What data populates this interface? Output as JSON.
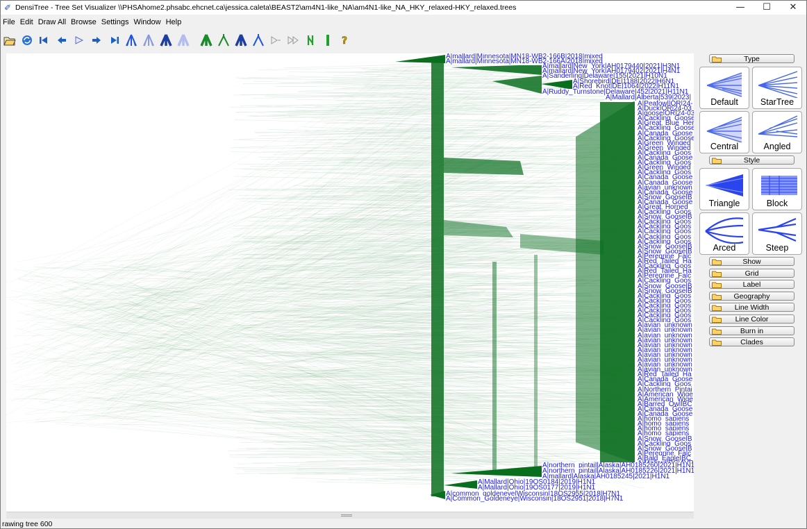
{
  "window": {
    "title": "DensiTree - Tree Set Visualizer \\\\PHSAhome2.phsabc.ehcnet.ca\\jessica.caleta\\BEAST2\\am4N1-like_NA\\am4N1-like_NA_HKY_relaxed-HKY_relaxed.trees",
    "minimize": "—",
    "maximize": "☐",
    "close": "✕"
  },
  "menu": [
    "File",
    "Edit",
    "Draw All",
    "Browse",
    "Settings",
    "Window",
    "Help"
  ],
  "toolbar_icons": [
    "open-icon",
    "refresh-icon",
    "first-tree-icon",
    "previous-tree-icon",
    "play-icon",
    "next-tree-icon",
    "last-tree-icon",
    "tree-view-blue-icon",
    "tree-view-light-icon",
    "tree-view-dark-icon",
    "tree-view-pale-icon",
    "tree-view-green-icon",
    "tree-view-green-light-icon",
    "tree-view-navy-icon",
    "tree-view-blue-outline-icon",
    "step-forward-icon",
    "step-forward-double-icon",
    "split-green-icon",
    "bar-green-icon",
    "help-icon"
  ],
  "colors": {
    "tree": "#0a6e1f",
    "label": "#1a1aee",
    "accent": "#ffd266"
  },
  "status": "rawing tree 600",
  "panel": {
    "sections": [
      "Type",
      "Style",
      "Show",
      "Grid",
      "Label",
      "Geography",
      "Line Width",
      "Line Color",
      "Burn in",
      "Clades"
    ],
    "type_tiles": [
      "Default",
      "StarTree",
      "Central",
      "Angled"
    ],
    "style_tiles": [
      "Triangle",
      "Block",
      "Arced",
      "Steep"
    ]
  },
  "tip_labels": {
    "top": [
      "A|mallard|Minnesota|MN18-WB2-166B|2018|mixed",
      "A|mallard|Minnesota|MN18-WB2-166A|2018|mixed",
      "A|mallard|New_York|AH0179440|2021|H3N1",
      "A|mallard|New_York|AH0179402|2021|H4N1",
      "A|Sanderling|Delaware|155|2021|H10N1",
      "A|Shorebird|DE|1188|2022|H6N1",
      "A|Red_Knot|DE|1064|2022|H11N1",
      "A|Ruddy_Turnstone|Delaware|452|2021|H11N1",
      "A|Mallard|Alberta|539|2023|"
    ],
    "column": [
      "A|Peafowl|OR|24-",
      "A|Duck|OR|24-03",
      "A|goose|OR|24-03",
      "A|Cackling_Goose",
      "A|Great_Blue_Her",
      "A|Cackling_Goose",
      "A|Canada_Goose",
      "A|Cackling_Goose",
      "A|Green_Winged",
      "A|Green_Winged",
      "A|Cackling_Goos",
      "A|Canada_Goose",
      "A|Cackling_Goos",
      "A|Green_Winged",
      "A|Cackling_Goos",
      "A|Canada_Goose",
      "A|Canada_Goose",
      "A|avian_unknown",
      "A|Canada_Goose",
      "A|Snow_Goose|B",
      "A|Canada_Goose",
      "A|Great_Horned_",
      "A|Cackling_Goos",
      "A|Snow_Goose|B",
      "A|Cackling_Goos",
      "A|Cackling_Goos",
      "A|Cackling_Goos",
      "A|Cackling_Goos",
      "A|Cackling_Goos",
      "A|Snow_Goose|B",
      "A|Snow_Goose|B",
      "A|Peregrine_Falc",
      "A|Red_Tailed_Ha",
      "A|Cackling_Goos",
      "A|Red_Tailed_Ha",
      "A|Peregrine_Falc",
      "A|Cackling_Goos",
      "A|Snow_Goose|B",
      "A|Snow_Goose|B",
      "A|Cackling_Goos",
      "A|Cackling_Goos",
      "A|Cackling_Goos",
      "A|Cackling_Goos",
      "A|Cackling_Goos",
      "A|Cackling_Goos",
      "A|avian_unknown",
      "A|avian_unknown",
      "A|avian_unknown",
      "A|avian_unknown",
      "A|avian_unknown",
      "A|avian_unknown",
      "A|avian_unknown",
      "A|avian_unknown",
      "A|avian_unknown",
      "A|avian_unknown",
      "A|Red_Tailed_Ha",
      "A|Canada_Goose",
      "A|Cackling_Goos",
      "A|Northern_Pintai",
      "A|American_Wige",
      "A|American_Wige",
      "A|Barred_Owl|BC",
      "A|Canada_Goose",
      "A|Canada_Goose",
      "A|homo_sapiens",
      "A|homo_sapiens",
      "A|homo_sapiens",
      "A|homo_sapiens",
      "A|Snow_Goose|B",
      "A|Cackling_Goos",
      "A|Snow_Goose|B",
      "A|Peregrine_Falc",
      "A|Bald_Eagle|BC",
      "A|Mallard|BC|AVP"
    ],
    "bottom": [
      "A|northern_pintail|Alaska|AH0185260|2021|H1N1",
      "A|northern_pintail|Alaska|AH0185226|2021|H1N1",
      "A|mallard|Alaska|AH0185245|2021|H1N1",
      "A|Mallard|Ohio|19OS0184|2019|H1N1",
      "A|Mallard|Ohio|19OS0177|2019|H1N1",
      "A|common_goldeneye|Wisconsin|18OS2955|2018|H7N1",
      "A|Common_Goldeneye|Wisconsin|18OS2951|2018|H7N1"
    ]
  }
}
